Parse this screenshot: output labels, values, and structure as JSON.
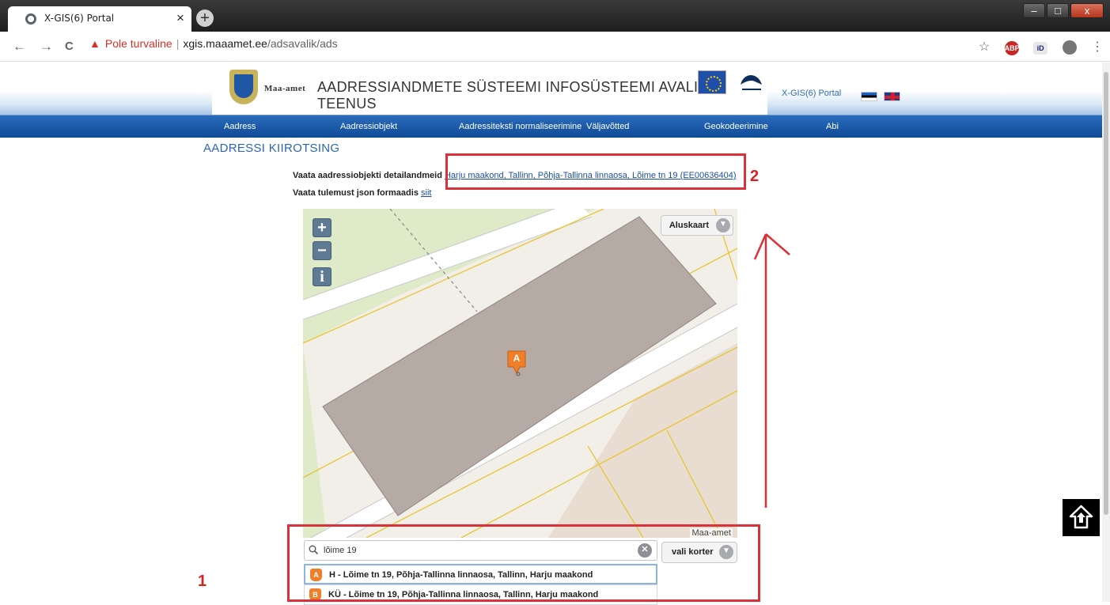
{
  "browser": {
    "tab_title": "X-GIS(6) Portal",
    "tab_close": "×",
    "new_tab": "+",
    "back": "←",
    "forward": "→",
    "reload": "C",
    "security_warning": "Pole turvaline",
    "separator": "|",
    "url_host": "xgis.maaamet.ee",
    "url_path": "/adsavalik/ads",
    "star": "☆",
    "menu": "⋮",
    "window_minimize": "–",
    "window_maximize": "□",
    "window_close": "x"
  },
  "header": {
    "org_name": "Maa-amet",
    "title": "AADRESSIANDMETE SÜSTEEMI INFOSÜSTEEMI AVALIK TEENUS",
    "portal_link": "X-GIS(6) Portal"
  },
  "nav": {
    "items": [
      {
        "label": "Aadress"
      },
      {
        "label": "Aadressiobjekt"
      },
      {
        "label": "Aadressiteksti normaliseerimine"
      },
      {
        "label": "Väljavõtted"
      },
      {
        "label": "Geokodeerimine"
      },
      {
        "label": "Abi"
      }
    ]
  },
  "content": {
    "heading": "AADRESSI KIIROTSING",
    "detail_label": "Vaata aadressiobjekti detailandmeid",
    "detail_link": "Harju maakond, Tallinn, Põhja-Tallinna linnaosa, Lõime tn 19 (EE00636404)",
    "json_label": "Vaata tulemust json formaadis",
    "json_link": "siit"
  },
  "map": {
    "zoom_in": "+",
    "zoom_out": "−",
    "info": "i",
    "basemap_label": "Aluskaart",
    "attribution": "Maa-amet",
    "marker_label": "A"
  },
  "search": {
    "value": "lõime 19",
    "korter_label": "vali korter",
    "suggestions": [
      {
        "badge": "A",
        "text": "H - Lõime tn 19, Põhja-Tallinna linnaosa, Tallinn, Harju maakond"
      },
      {
        "badge": "B",
        "text": "KÜ - Lõime tn 19, Põhja-Tallinna linnaosa, Tallinn, Harju maakond"
      }
    ]
  },
  "annotations": {
    "label_1": "1",
    "label_2": "2"
  },
  "colors": {
    "nav_blue": "#1a5aab",
    "annotation_red": "#d9323a",
    "marker_orange": "#ef7f28",
    "building": "#b5aaa4"
  }
}
